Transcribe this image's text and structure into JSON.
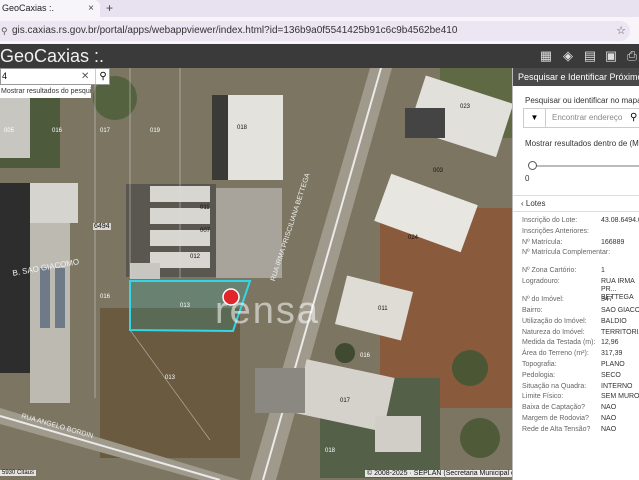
{
  "browser": {
    "tab_title": "GeoCaxias :.",
    "tab_close": "×",
    "new_tab": "+",
    "url": "gis.caxias.rs.gov.br/portal/apps/webappviewer/index.html?id=136b9a0f5541425b91c6c9b4562be410"
  },
  "app": {
    "title": "GeoCaxias :."
  },
  "map_search": {
    "value": "4",
    "suggestion": "Mostrar resultados do pesquisa..."
  },
  "map": {
    "watermark": "rensa",
    "road_label_1": "RUA IRMA PRISCILIANA BETTEGA",
    "road_label_2": "RUA ANGELO BORDIN",
    "area_label": "B. SAO GIACOMO",
    "lot_number": "6494",
    "lot_codes": [
      "005",
      "016",
      "017",
      "019",
      "018",
      "011",
      "013",
      "012",
      "016",
      "013",
      "023",
      "024",
      "011",
      "016",
      "017",
      "018",
      "003",
      "007"
    ],
    "scale_text": "5930 Citaus",
    "copyright": "© 2008-2025 · SEPLAN (Secretaria Municipal d..."
  },
  "panel": {
    "title": "Pesquisar e Identificar Próximo",
    "search_label": "Pesquisar ou identificar no mapa",
    "address_placeholder": "Encontrar endereço",
    "results_label": "Mostrar resultados dentro de (Metros)",
    "slider_value": "0",
    "slider_fraction": 0,
    "lotes_label": "Lotes",
    "attributes": [
      {
        "k": "Inscrição do Lote:",
        "v": "43.08.6494.0..."
      },
      {
        "k": "Inscrições Anteriores:",
        "v": ""
      },
      {
        "k": "Nº Matrícula:",
        "v": "166889"
      },
      {
        "k": "Nº Matrícula Complementar:",
        "v": ""
      },
      {
        "k": "Nº Zona Cartório:",
        "v": "1"
      },
      {
        "k": "Logradouro:",
        "v": "RUA IRMA PR... BETTEGA"
      },
      {
        "k": "Nº do Imóvel:",
        "v": "347"
      },
      {
        "k": "Bairro:",
        "v": "SAO GIACOMO"
      },
      {
        "k": "Utilização do Imóvel:",
        "v": "BALDIO"
      },
      {
        "k": "Natureza do Imóvel:",
        "v": "TERRITORIAL"
      },
      {
        "k": "Medida da Testada (m):",
        "v": "12,96"
      },
      {
        "k": "Área do Terreno (m²):",
        "v": "317,39"
      },
      {
        "k": "Topografia:",
        "v": "PLANO"
      },
      {
        "k": "Pedologia:",
        "v": "SECO"
      },
      {
        "k": "Situação na Quadra:",
        "v": "INTERNO"
      },
      {
        "k": "Limite Físico:",
        "v": "SEM MURO"
      },
      {
        "k": "Baixa de Captação?",
        "v": "NAO"
      },
      {
        "k": "Margem de Rodovia?",
        "v": "NAO"
      },
      {
        "k": "Rede de Alta Tensão?",
        "v": "NAO"
      }
    ]
  }
}
